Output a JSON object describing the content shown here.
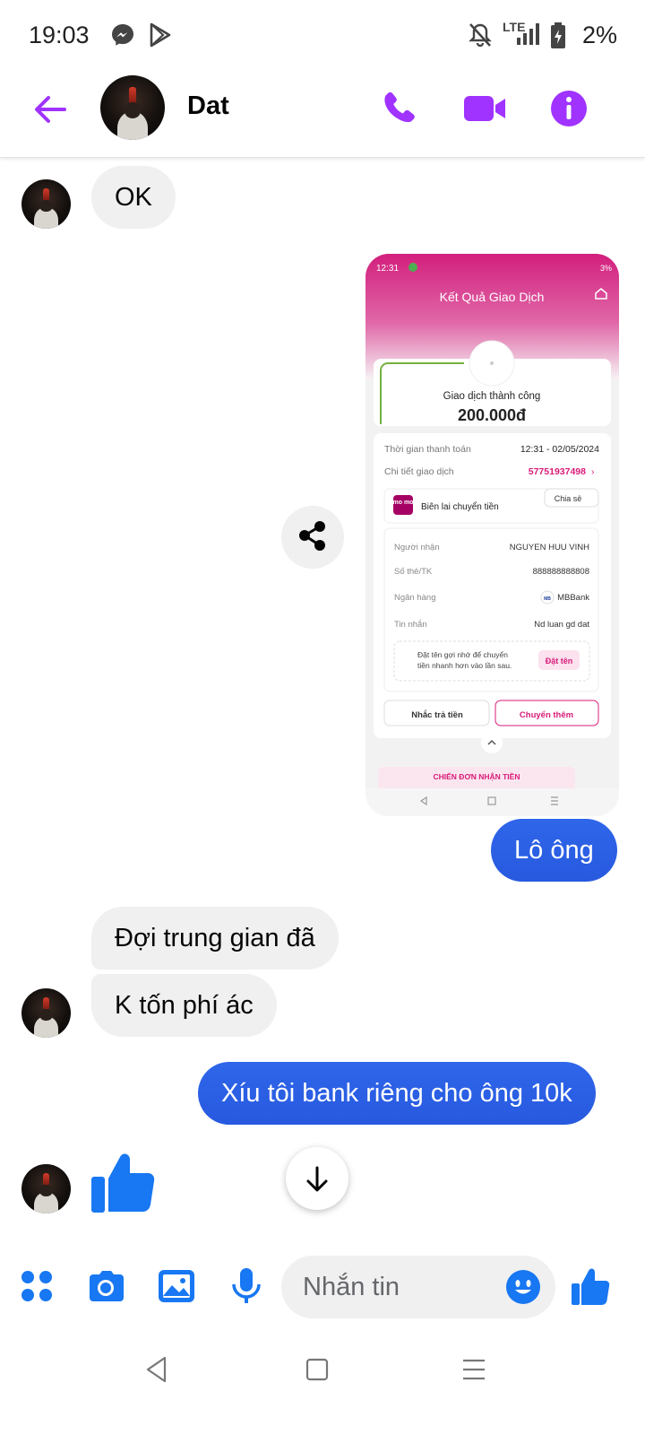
{
  "status_bar": {
    "time": "19:03",
    "battery_percent": "2%",
    "network_label": "LTE",
    "icons": [
      "messenger-icon",
      "play-store-icon",
      "mute-icon",
      "signal-icon",
      "battery-icon"
    ]
  },
  "header": {
    "contact_name": "Dat",
    "icons": [
      "back-arrow-icon",
      "phone-icon",
      "video-call-icon",
      "info-icon"
    ],
    "accent_color": "#a033ff"
  },
  "messages": [
    {
      "direction": "in",
      "text": "OK"
    },
    {
      "direction": "out",
      "type": "image",
      "description_key": "shared_screenshot"
    },
    {
      "direction": "out",
      "text": "Lô ông"
    },
    {
      "direction": "in",
      "text": "Đợi trung gian đã"
    },
    {
      "direction": "in",
      "text": "K tốn phí ác"
    },
    {
      "direction": "out",
      "text": "Xíu tôi bank riêng cho ông 10k"
    },
    {
      "direction": "in",
      "type": "like"
    }
  ],
  "shared_screenshot": {
    "status_time": "12:31",
    "status_battery": "3%",
    "title": "Kết Quả Giao Dịch",
    "result_label": "Giao dịch thành công",
    "amount": "200.000đ",
    "time_label": "Thời gian thanh toán",
    "time_value": "12:31 - 02/05/2024",
    "detail_label": "Chi tiết giao dịch",
    "detail_value": "57751937498",
    "momo_logo": "mo mo",
    "receipt_label": "Biên lai chuyển tiền",
    "share_label": "Chia sẻ",
    "recipient_label": "Người nhận",
    "recipient_value": "NGUYEN HUU VINH",
    "account_label": "Số thẻ/TK",
    "account_value": "888888888808",
    "bank_label": "Ngân hàng",
    "bank_value": "MBBank",
    "bank_logo": "MB",
    "message_label": "Tin nhắn",
    "message_value": "Nd luan gd dat",
    "hint_text_1": "Đặt tên gợi nhớ để chuyển",
    "hint_text_2": "tiền nhanh hơn vào lần sau.",
    "name_button": "Đặt tên",
    "remind_button": "Nhắc trả tiền",
    "transfer_more_button": "Chuyển thêm",
    "banner_text": "CHIẾN ĐƠN NHẬN TIỀN",
    "brand_color": "#d81b78"
  },
  "composer": {
    "placeholder": "Nhắn tin",
    "icons": [
      "apps-icon",
      "camera-icon",
      "gallery-icon",
      "microphone-icon",
      "emoji-icon",
      "like-icon"
    ],
    "accent_color": "#1877f2"
  },
  "nav_bar": {
    "icons": [
      "back-triangle-icon",
      "home-square-icon",
      "menu-lines-icon"
    ]
  }
}
